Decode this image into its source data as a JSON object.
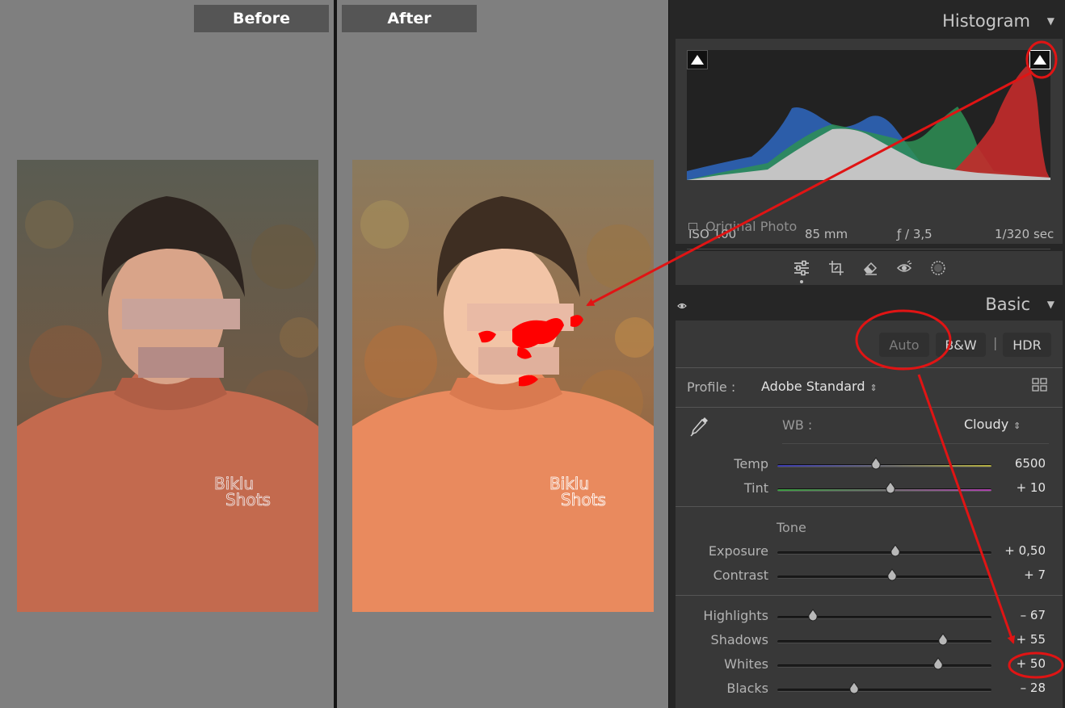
{
  "compare": {
    "before_label": "Before",
    "after_label": "After"
  },
  "histogram": {
    "title": "Histogram",
    "iso": "ISO 100",
    "focal": "85 mm",
    "aperture": "ƒ / 3,5",
    "shutter": "1/320 sec",
    "original_photo": "Original Photo",
    "highlight_clipping": "on"
  },
  "tools": [
    "edit-icon",
    "crop-icon",
    "heal-icon",
    "redeye-icon",
    "mask-icon"
  ],
  "basic": {
    "title": "Basic",
    "auto": "Auto",
    "bw": "B&W",
    "hdr": "HDR",
    "profile_label": "Profile :",
    "profile_value": "Adobe Standard",
    "wb_label": "WB :",
    "wb_value": "Cloudy",
    "tone_label": "Tone",
    "sliders": [
      {
        "label": "Temp",
        "value": "6500",
        "position": 0.46
      },
      {
        "label": "Tint",
        "value": "+ 10",
        "position": 0.53
      },
      {
        "label": "Exposure",
        "value": "+ 0,50",
        "position": 0.55
      },
      {
        "label": "Contrast",
        "value": "+ 7",
        "position": 0.535
      },
      {
        "label": "Highlights",
        "value": "– 67",
        "position": 0.165
      },
      {
        "label": "Shadows",
        "value": "+ 55",
        "position": 0.775
      },
      {
        "label": "Whites",
        "value": "+ 50",
        "position": 0.75
      },
      {
        "label": "Blacks",
        "value": "– 28",
        "position": 0.36
      }
    ]
  },
  "colors": {
    "panel": "#383838",
    "annotation": "#e01414",
    "clipping": "#ff0000"
  }
}
